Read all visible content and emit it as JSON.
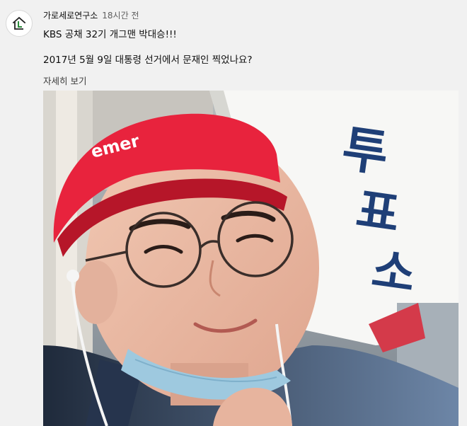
{
  "post": {
    "channel_name": "가로세로연구소",
    "time_ago": "18시간 전",
    "line1": "KBS 공채 32기 개그맨 박대승!!!",
    "line2": "2017년 5월 9일 대통령 선거에서 문재인 찍었나요?",
    "more_label": "자세히 보기"
  },
  "photo": {
    "sign_text": "투표소",
    "cap_text": "emer"
  },
  "icons": {
    "avatar": "house-logo-icon"
  },
  "colors": {
    "page_bg": "#f1f1f1",
    "cap_red": "#e8233d",
    "sign_blue": "#1f3f77"
  }
}
